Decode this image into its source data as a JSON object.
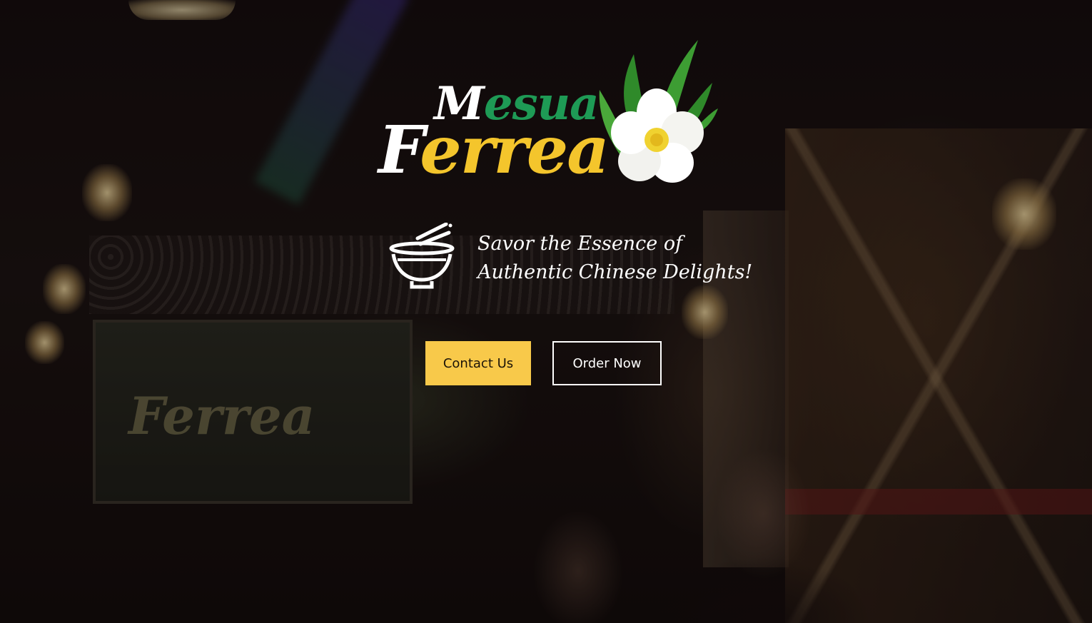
{
  "brand": {
    "logo_top_word": "esua",
    "logo_top_initial": "M",
    "logo_bottom_word": "errea",
    "logo_bottom_initial": "F",
    "colors": {
      "green": "#1e9a55",
      "yellow": "#f4c52c",
      "white": "#ffffff"
    }
  },
  "hero": {
    "icon": "noodle-bowl-icon",
    "tagline_line1": "Savor the Essence of",
    "tagline_line2": "Authentic Chinese Delights!"
  },
  "actions": {
    "contact_label": "Contact Us",
    "order_label": "Order Now",
    "contact_color": "#f8c94a"
  }
}
